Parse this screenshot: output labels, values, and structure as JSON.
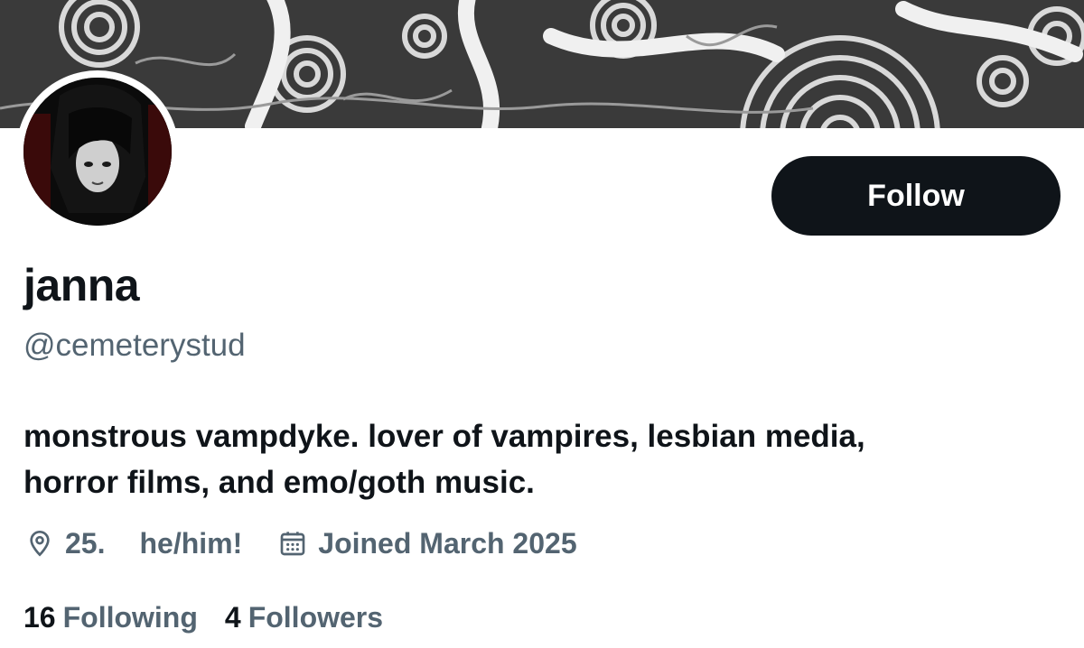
{
  "profile": {
    "display_name": "janna",
    "handle": "@cemeterystud",
    "bio_line1": "monstrous vampdyke. lover of vampires, lesbian media,",
    "bio_line2": "horror films, and emo/goth music.",
    "location": "25.",
    "pronouns": "he/him!",
    "joined": "Joined March 2025"
  },
  "actions": {
    "follow_label": "Follow"
  },
  "stats": {
    "following_count": "16",
    "following_label": "Following",
    "followers_count": "4",
    "followers_label": "Followers"
  },
  "icons": {
    "location": "location-pin-icon",
    "joined": "calendar-icon"
  },
  "colors": {
    "text_primary": "#0f1419",
    "text_secondary": "#536471",
    "button_bg": "#0f1419",
    "button_text": "#ffffff"
  }
}
